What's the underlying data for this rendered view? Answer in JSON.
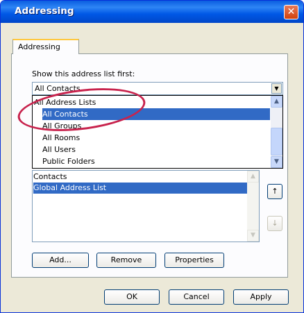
{
  "window": {
    "title": "Addressing",
    "close_glyph": "✕"
  },
  "tabs": [
    {
      "label": "Addressing"
    }
  ],
  "show_first": {
    "label": "Show this address list first:",
    "selected": "All Contacts",
    "options": [
      "All Address Lists",
      "All Contacts",
      "All Groups",
      "All Rooms",
      "All Users",
      "Public Folders"
    ],
    "highlighted": "All Contacts"
  },
  "address_lists": {
    "items": [
      "Contacts",
      "Global Address List"
    ],
    "selected": "Global Address List"
  },
  "buttons": {
    "move_up": "↑",
    "move_down": "↓",
    "add": "Add...",
    "remove": "Remove",
    "properties": "Properties",
    "ok": "OK",
    "cancel": "Cancel",
    "apply": "Apply"
  },
  "colors": {
    "annotation": "#c8234d",
    "selection": "#316ac5",
    "title_bar": "#0058e6"
  }
}
